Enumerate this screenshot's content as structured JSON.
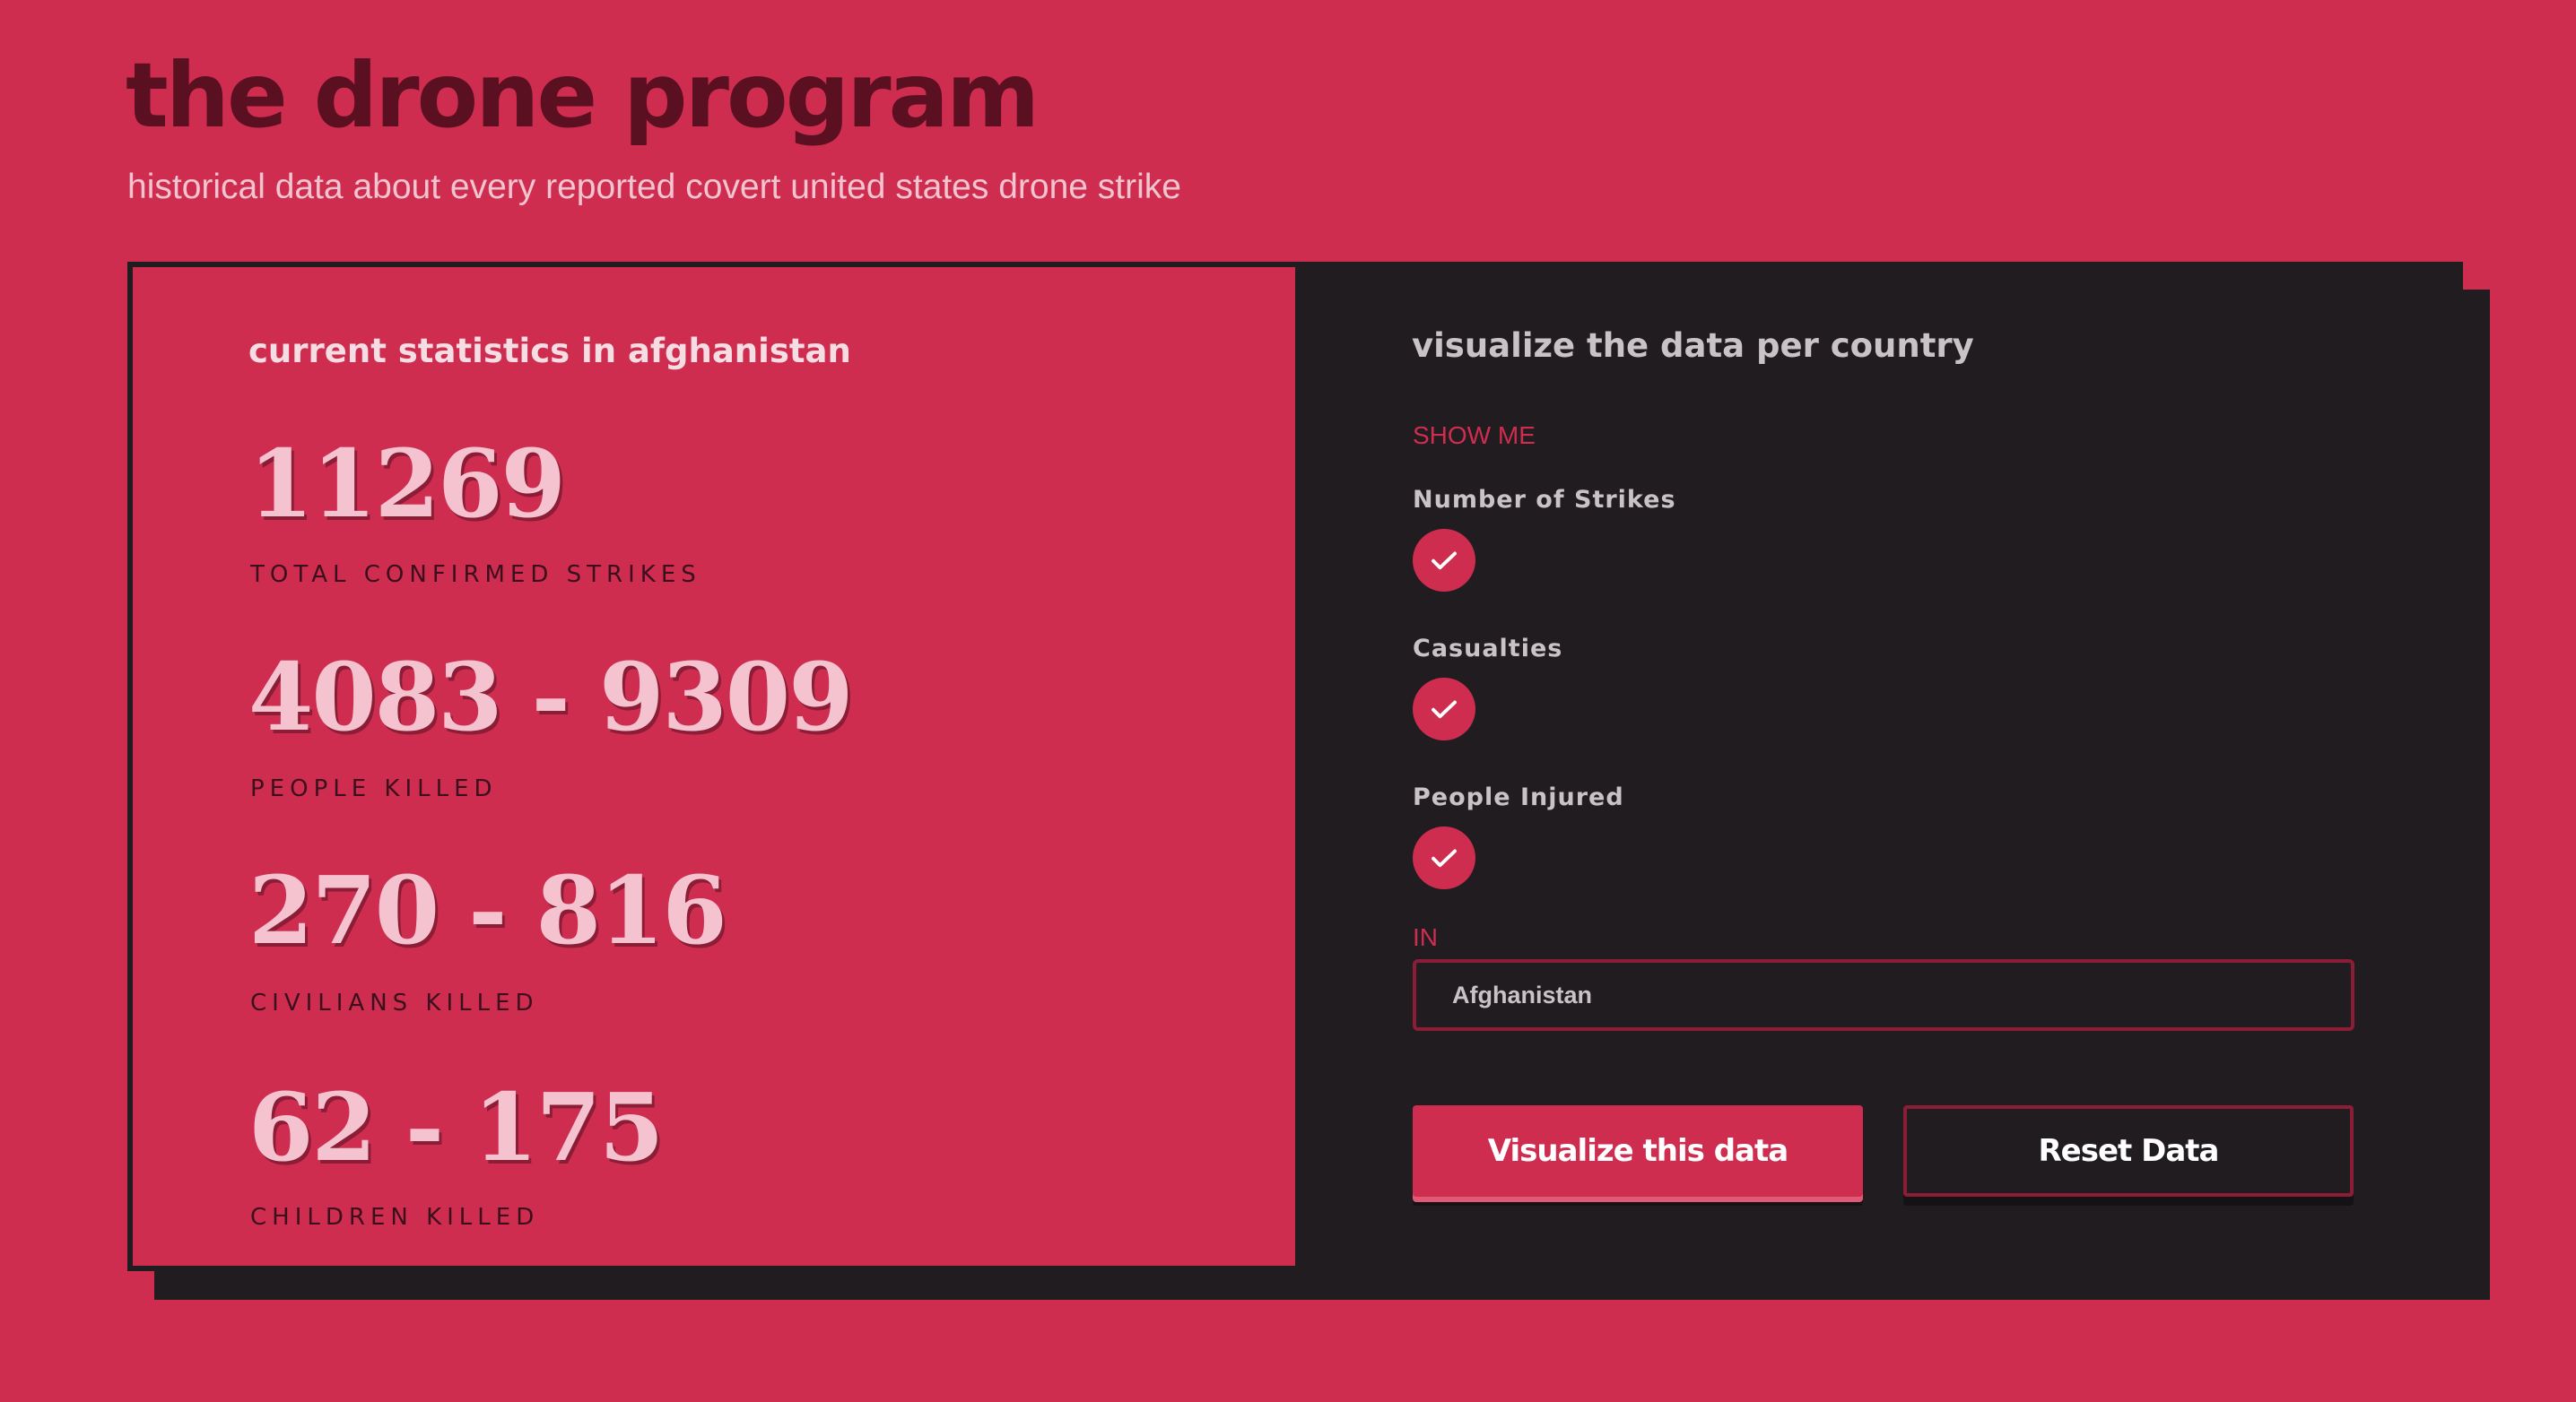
{
  "header": {
    "title": "the drone program",
    "subtitle": "historical data about every reported covert united states drone strike"
  },
  "stats_panel": {
    "heading": "current statistics in afghanistan",
    "stats": [
      {
        "value": "11269",
        "label": "TOTAL CONFIRMED STRIKES"
      },
      {
        "value": "4083 - 9309",
        "label": "PEOPLE KILLED"
      },
      {
        "value": "270 - 816",
        "label": "CIVILIANS KILLED"
      },
      {
        "value": "62 - 175",
        "label": "CHILDREN KILLED"
      }
    ]
  },
  "controls_panel": {
    "heading": "visualize the data per country",
    "show_me_label": "SHOW ME",
    "options": [
      {
        "label": "Number of Strikes",
        "checked": true
      },
      {
        "label": "Casualties",
        "checked": true
      },
      {
        "label": "People Injured",
        "checked": true
      }
    ],
    "in_label": "IN",
    "country_select": {
      "value": "Afghanistan"
    },
    "visualize_button": "Visualize this data",
    "reset_button": "Reset Data"
  },
  "colors": {
    "accent": "#cf2d50",
    "dark": "#201c20",
    "title": "#5a1020",
    "stat_number": "#f4c3cf"
  },
  "icons": {
    "checkbox": "checkmark-icon"
  }
}
